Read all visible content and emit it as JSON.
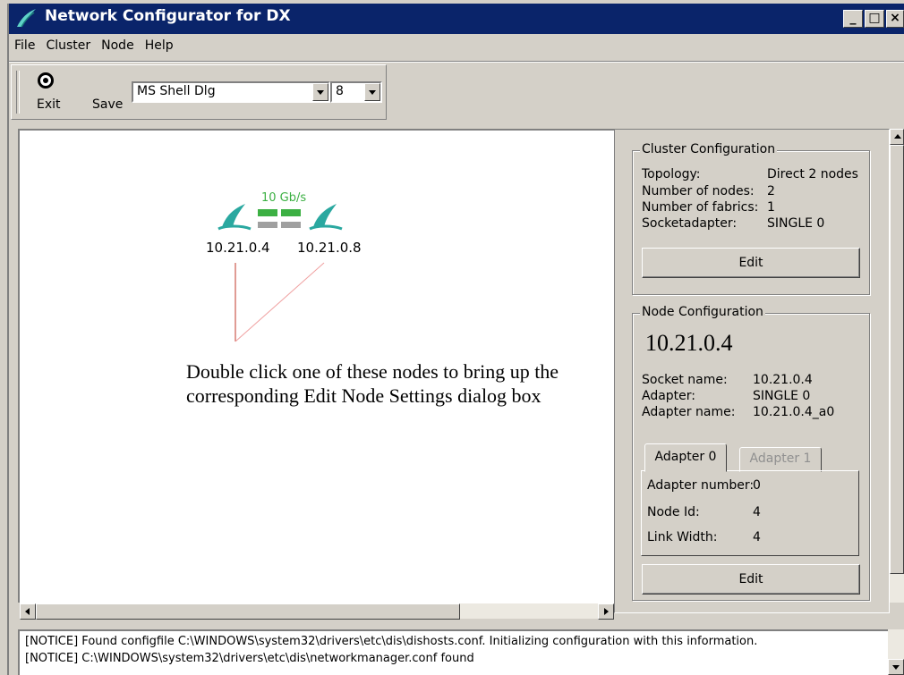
{
  "window": {
    "title": "Network Configurator for DX",
    "minimize": "_",
    "maximize": "□",
    "close": "×"
  },
  "menu": [
    "File",
    "Cluster",
    "Node",
    "Help"
  ],
  "toolbar": {
    "exit_label": "Exit",
    "save_label": "Save",
    "font_name": "MS Shell Dlg",
    "font_size": "8"
  },
  "topology": {
    "speed": "10 Gb/s",
    "nodes": [
      "10.21.0.4",
      "10.21.0.8"
    ]
  },
  "annotation": "Double click one of these nodes to bring up the corresponding Edit Node Settings dialog box",
  "cluster_config": {
    "legend": "Cluster Configuration",
    "rows": [
      {
        "label": "Topology:",
        "value": "Direct 2 nodes"
      },
      {
        "label": "Number of nodes:",
        "value": "2"
      },
      {
        "label": "Number of fabrics:",
        "value": "1"
      },
      {
        "label": "Socketadapter:",
        "value": "SINGLE 0"
      }
    ],
    "edit_label": "Edit"
  },
  "node_config": {
    "legend": "Node Configuration",
    "node": "10.21.0.4",
    "rows": [
      {
        "label": "Socket name:",
        "value": "10.21.0.4"
      },
      {
        "label": "Adapter:",
        "value": "SINGLE 0"
      },
      {
        "label": "Adapter name:",
        "value": "10.21.0.4_a0"
      }
    ],
    "tabs": [
      "Adapter 0",
      "Adapter 1"
    ],
    "active_tab": "Adapter 0",
    "adapter_rows": [
      {
        "label": "Adapter number:",
        "value": "0"
      },
      {
        "label": "Node Id:",
        "value": "4"
      },
      {
        "label": "Link Width:",
        "value": "4"
      }
    ],
    "edit_label": "Edit"
  },
  "log": [
    "[NOTICE] Found configfile C:\\WINDOWS\\system32\\drivers\\etc\\dis\\dishosts.conf. Initializing configuration with this information.",
    "[NOTICE] C:\\WINDOWS\\system32\\drivers\\etc\\dis\\networkmanager.conf found"
  ],
  "colors": {
    "titlebar": "#0a246a",
    "link_green": "#3cb043",
    "link_grey": "#a0a0a0",
    "node_teal": "#2aa8a0",
    "leader_line": "#c0392b"
  }
}
